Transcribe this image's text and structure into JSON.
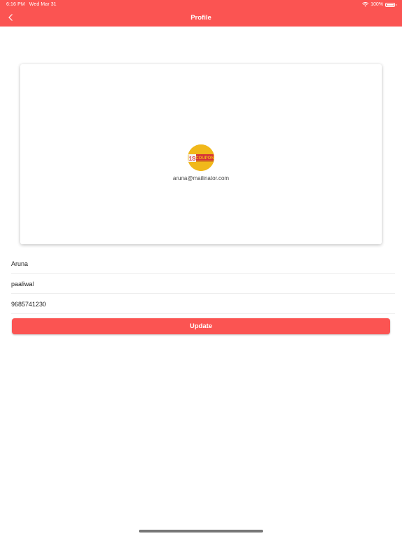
{
  "status_bar": {
    "time": "6:16 PM",
    "date": "Wed Mar 31",
    "battery": "100%"
  },
  "header": {
    "title": "Profile",
    "back_icon": "chevron-left-icon"
  },
  "profile_card": {
    "logo_text_left": "1S",
    "logo_text_right": "COUPON",
    "email": "aruna@mailinator.com"
  },
  "form": {
    "first_name": "Aruna",
    "last_name": "paaliwal",
    "phone": "9685741230",
    "update_label": "Update"
  },
  "colors": {
    "accent": "#fb5452",
    "logo_bg": "#f1b81a"
  }
}
